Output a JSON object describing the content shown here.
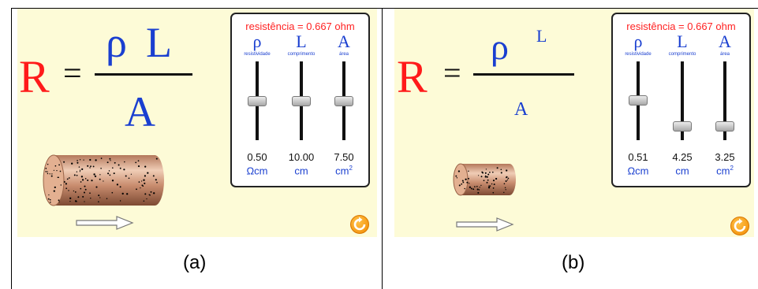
{
  "panels": [
    {
      "id": "a",
      "formula": {
        "r": "R",
        "eq": "=",
        "rho": "ρ",
        "l": "L",
        "a": "A"
      },
      "controls": {
        "resistance_text": "resistência = 0.667 ohm",
        "columns": [
          {
            "symbol": "ρ",
            "name": "resistividade",
            "value": "0.50",
            "unit": "Ωcm",
            "unit_sup": "",
            "level": 0.5
          },
          {
            "symbol": "L",
            "name": "comprimento",
            "value": "10.00",
            "unit": "cm",
            "unit_sup": "",
            "level": 0.5
          },
          {
            "symbol": "A",
            "name": "área",
            "value": "7.50",
            "unit": "cm",
            "unit_sup": "2",
            "level": 0.5
          }
        ]
      },
      "caption": "(a)"
    },
    {
      "id": "b",
      "formula": {
        "r": "R",
        "eq": "=",
        "rho": "ρ",
        "l": "L",
        "a": "A"
      },
      "controls": {
        "resistance_text": "resistência = 0.667 ohm",
        "columns": [
          {
            "symbol": "ρ",
            "name": "resistividade",
            "value": "0.51",
            "unit": "Ωcm",
            "unit_sup": "",
            "level": 0.51
          },
          {
            "symbol": "L",
            "name": "comprimento",
            "value": "4.25",
            "unit": "cm",
            "unit_sup": "",
            "level": 0.18
          },
          {
            "symbol": "A",
            "name": "área",
            "value": "3.25",
            "unit": "cm",
            "unit_sup": "2",
            "level": 0.18
          }
        ]
      },
      "caption": "(b)"
    }
  ],
  "icons": {
    "reset": "reset-icon",
    "arrow": "arrow-right-icon"
  },
  "colors": {
    "background": "#fdfbd7",
    "R": "#ff1a1a",
    "symbols": "#1a3fd0",
    "resistance_text": "#ff2222",
    "reset": "#f28a00"
  }
}
